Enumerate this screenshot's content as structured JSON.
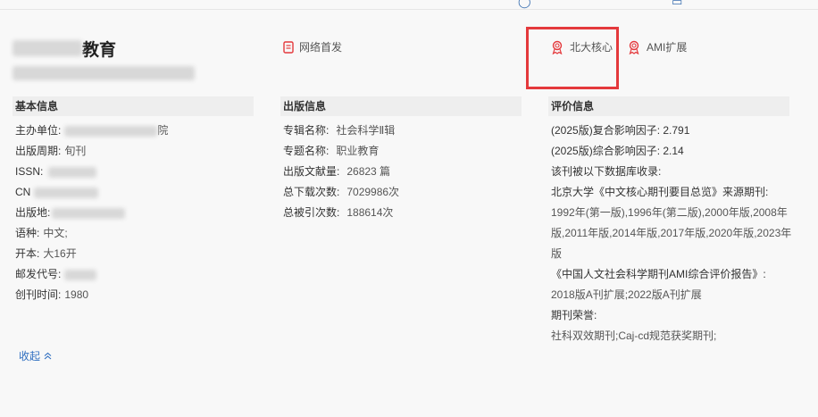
{
  "journal": {
    "name_suffix": "教育"
  },
  "badges": [
    {
      "label": "网络首发",
      "icon": "document-icon"
    },
    {
      "label": "北大核心",
      "icon": "award-ribbon-icon"
    },
    {
      "label": "AMI扩展",
      "icon": "award-ribbon-icon"
    }
  ],
  "colors": {
    "accent_red": "#e4393c",
    "link_blue": "#2f6ec0"
  },
  "basic": {
    "header": "基本信息",
    "sponsor_label": "主办单位:",
    "sponsor_tail": "院",
    "period_label": "出版周期:",
    "period_value": "旬刊",
    "issn_label": "ISSN:",
    "cn_label": "CN",
    "place_label": "出版地:",
    "language_label": "语种:",
    "language_value": "中文;",
    "format_label": "开本:",
    "format_value": "大16开",
    "postal_label": "邮发代号:",
    "founded_label": "创刊时间:",
    "founded_value": "1980"
  },
  "publish": {
    "header": "出版信息",
    "series_label": "专辑名称:",
    "series_value": "社会科学Ⅱ辑",
    "topic_label": "专题名称:",
    "topic_value": "职业教育",
    "docs_label": "出版文献量:",
    "docs_value": "26823 篇",
    "downloads_label": "总下载次数:",
    "downloads_value": "7029986次",
    "citations_label": "总被引次数:",
    "citations_value": "188614次"
  },
  "evaluation": {
    "header": "评价信息",
    "compound_if": "(2025版)复合影响因子: 2.791",
    "comprehensive_if": "(2025版)综合影响因子: 2.14",
    "indexed_intro": "该刊被以下数据库收录:",
    "pku_title": "北京大学《中文核心期刊要目总览》来源期刊:",
    "pku_years": "1992年(第一版),1996年(第二版),2000年版,2008年版,2011年版,2014年版,2017年版,2020年版,2023年版",
    "ami_title": "《中国人文社会科学期刊AMI综合评价报告》:",
    "ami_years": "2018版A刊扩展;2022版A刊扩展",
    "honors_title": "期刊荣誉:",
    "honors_value": "社科双效期刊;Caj-cd规范获奖期刊;"
  },
  "collapse_label": "收起"
}
